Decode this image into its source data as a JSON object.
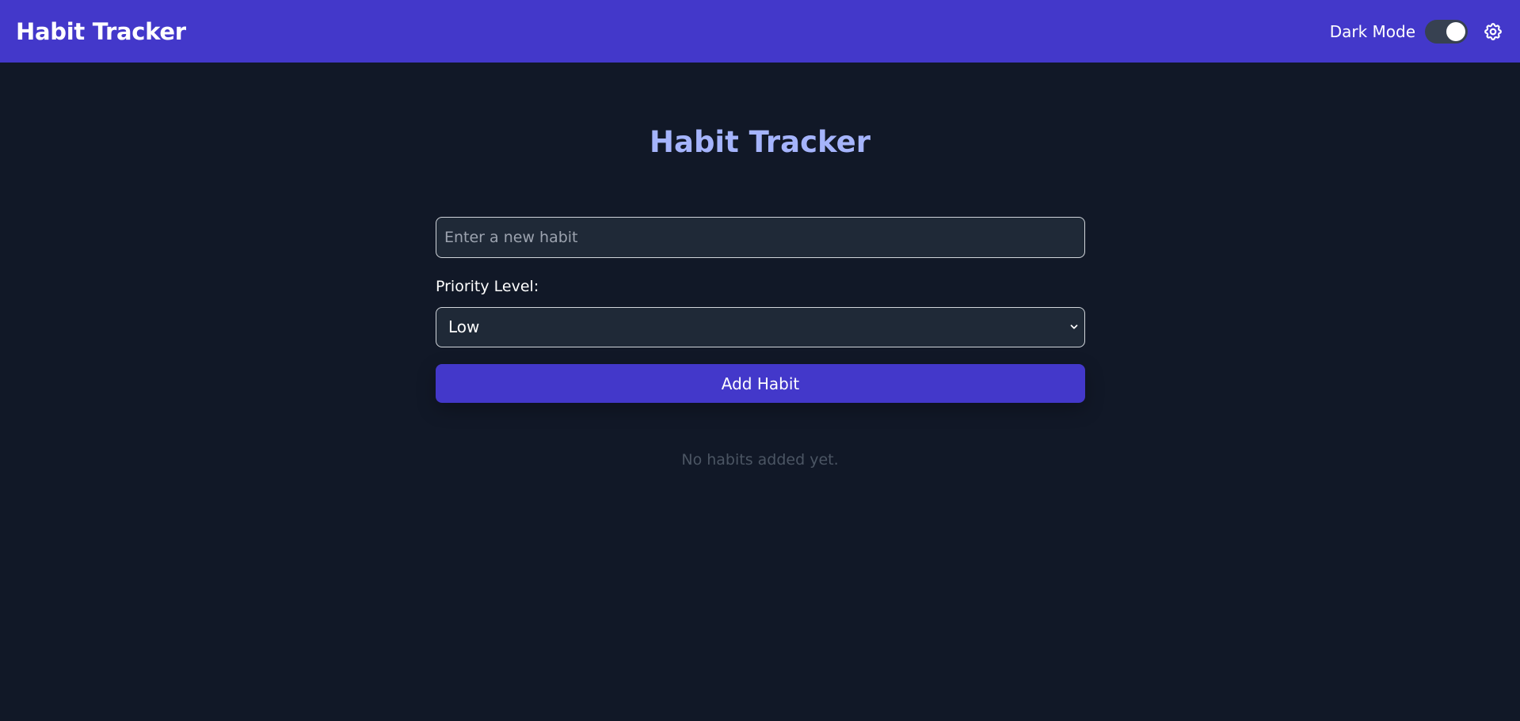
{
  "header": {
    "title": "Habit Tracker",
    "dark_mode_label": "Dark Mode",
    "dark_mode_on": true,
    "settings_icon": "gear-icon"
  },
  "main": {
    "title": "Habit Tracker",
    "habit_input": {
      "value": "",
      "placeholder": "Enter a new habit"
    },
    "priority_label": "Priority Level:",
    "priority_select": {
      "selected": "Low"
    },
    "add_button_label": "Add Habit",
    "empty_message": "No habits added yet."
  },
  "colors": {
    "header_bg": "#4338ca",
    "page_bg": "#111827",
    "title_accent": "#a5b4fc",
    "button_bg": "#4338ca"
  }
}
